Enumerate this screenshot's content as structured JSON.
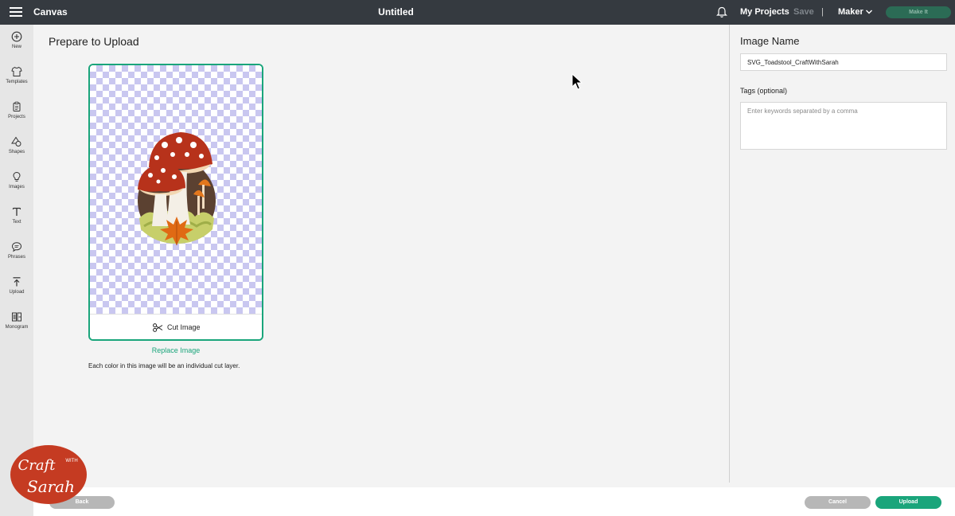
{
  "topbar": {
    "app_title": "Canvas",
    "doc_title": "Untitled",
    "my_projects": "My Projects",
    "save": "Save",
    "separator": "|",
    "machine": "Maker",
    "make_it": "Make It"
  },
  "sidebar": {
    "items": [
      {
        "label": "New",
        "icon": "plus-circle-icon"
      },
      {
        "label": "Templates",
        "icon": "shirt-icon"
      },
      {
        "label": "Projects",
        "icon": "clipboard-icon"
      },
      {
        "label": "Shapes",
        "icon": "shapes-icon"
      },
      {
        "label": "Images",
        "icon": "lightbulb-icon"
      },
      {
        "label": "Text",
        "icon": "text-icon"
      },
      {
        "label": "Phrases",
        "icon": "speech-bubble-icon"
      },
      {
        "label": "Upload",
        "icon": "upload-arrow-icon"
      },
      {
        "label": "Monogram",
        "icon": "monogram-icon"
      }
    ]
  },
  "main": {
    "title": "Prepare to Upload",
    "cut_label": "Cut Image",
    "replace_link": "Replace Image",
    "info": "Each color in this image will be an individual cut layer."
  },
  "panel": {
    "image_name_label": "Image Name",
    "image_name_value": "SVG_Toadstool_CraftWithSarah",
    "tags_label": "Tags (optional)",
    "tags_placeholder": "Enter keywords separated by a comma"
  },
  "footer": {
    "back": "Back",
    "cancel": "Cancel",
    "upload": "Upload"
  },
  "watermark": {
    "line1": "Craft",
    "line2": "WITH",
    "line3": "Sarah"
  },
  "colors": {
    "accent": "#1aa57b",
    "topbar": "#353a40",
    "make_it": "#2b6b55"
  }
}
